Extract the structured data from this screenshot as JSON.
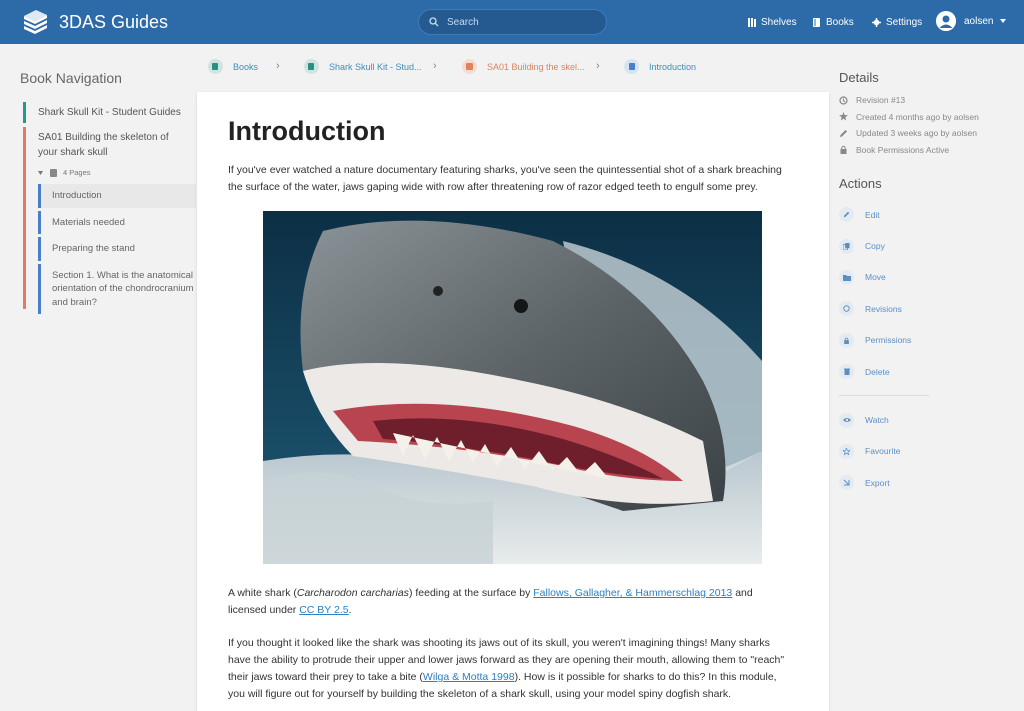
{
  "header": {
    "app_title": "3DAS Guides",
    "search_placeholder": "Search",
    "nav": [
      "Shelves",
      "Books",
      "Settings"
    ],
    "user": "aolsen"
  },
  "left_sidebar": {
    "title": "Book Navigation",
    "book": "Shark Skull Kit - Student Guides",
    "chapter": "SA01 Building the skeleton of your shark skull",
    "pages_count": "4 Pages",
    "pages": [
      "Introduction",
      "Materials needed",
      "Preparing the stand",
      "Section 1. What is the anatomical orientation of the chondrocranium and brain?"
    ]
  },
  "breadcrumb": [
    "Books",
    "Shark Skull Kit - Stud...",
    "SA01 Building the skel...",
    "Introduction"
  ],
  "content": {
    "title": "Introduction",
    "p1": "If you've ever watched a nature documentary featuring sharks, you've seen the quintessential shot of a shark breaching the surface of the water, jaws gaping wide with row after threatening row of razor edged teeth to engulf some prey.",
    "caption_a": "A white shark (",
    "caption_species": "Carcharodon carcharias",
    "caption_b": ") feeding at the surface by ",
    "caption_link": "Fallows, Gallagher, & Hammerschlag 2013",
    "caption_c": " and licensed under ",
    "caption_license": "CC BY 2.5",
    "caption_d": ".",
    "p2_a": "If you thought it looked like the shark was shooting its jaws out of its skull, you weren't imagining things! Many sharks have the ability to protrude their upper and lower jaws forward as they are opening their mouth, allowing them to \"reach\" their jaws toward their prey to take a bite (",
    "p2_link": "Wilga & Motta 1998",
    "p2_b": "). How is it possible for sharks to do this? In this module, you will figure out for yourself by building the skeleton of a shark skull, using your model spiny dogfish shark."
  },
  "details": {
    "title": "Details",
    "items": [
      "Revision #13",
      "Created 4 months ago by aolsen",
      "Updated 3 weeks ago by aolsen",
      "Book Permissions Active"
    ]
  },
  "actions": {
    "title": "Actions",
    "items": [
      "Edit",
      "Copy",
      "Move",
      "Revisions",
      "Permissions",
      "Delete"
    ],
    "items2": [
      "Watch",
      "Favourite",
      "Export"
    ]
  }
}
